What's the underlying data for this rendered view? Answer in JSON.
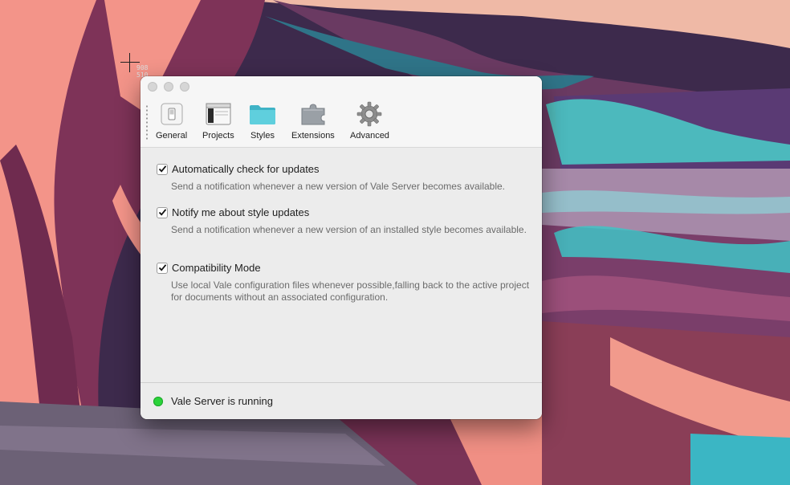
{
  "cursor": {
    "coord_x": "908",
    "coord_y": "510"
  },
  "toolbar": {
    "items": [
      {
        "label": "General",
        "icon": "toggle-switch-icon"
      },
      {
        "label": "Projects",
        "icon": "window-panes-icon"
      },
      {
        "label": "Styles",
        "icon": "folder-icon"
      },
      {
        "label": "Extensions",
        "icon": "puzzle-icon"
      },
      {
        "label": "Advanced",
        "icon": "gear-icon"
      }
    ]
  },
  "preferences": [
    {
      "label": "Automatically check for updates",
      "checked": true,
      "description": "Send a notification whenever a new version of Vale Server becomes available."
    },
    {
      "label": "Notify me about style updates",
      "checked": true,
      "description": "Send a notification whenever a new version of an installed style becomes available."
    },
    {
      "label": "Compatibility Mode",
      "checked": true,
      "description": "Use local Vale configuration files whenever possible,falling back to the active project for documents without an associated configuration."
    }
  ],
  "status": {
    "text": "Vale Server is running",
    "color": "#2bd33a"
  },
  "colors": {
    "folder": "#4cc4d6",
    "accent": "#2bd33a"
  }
}
